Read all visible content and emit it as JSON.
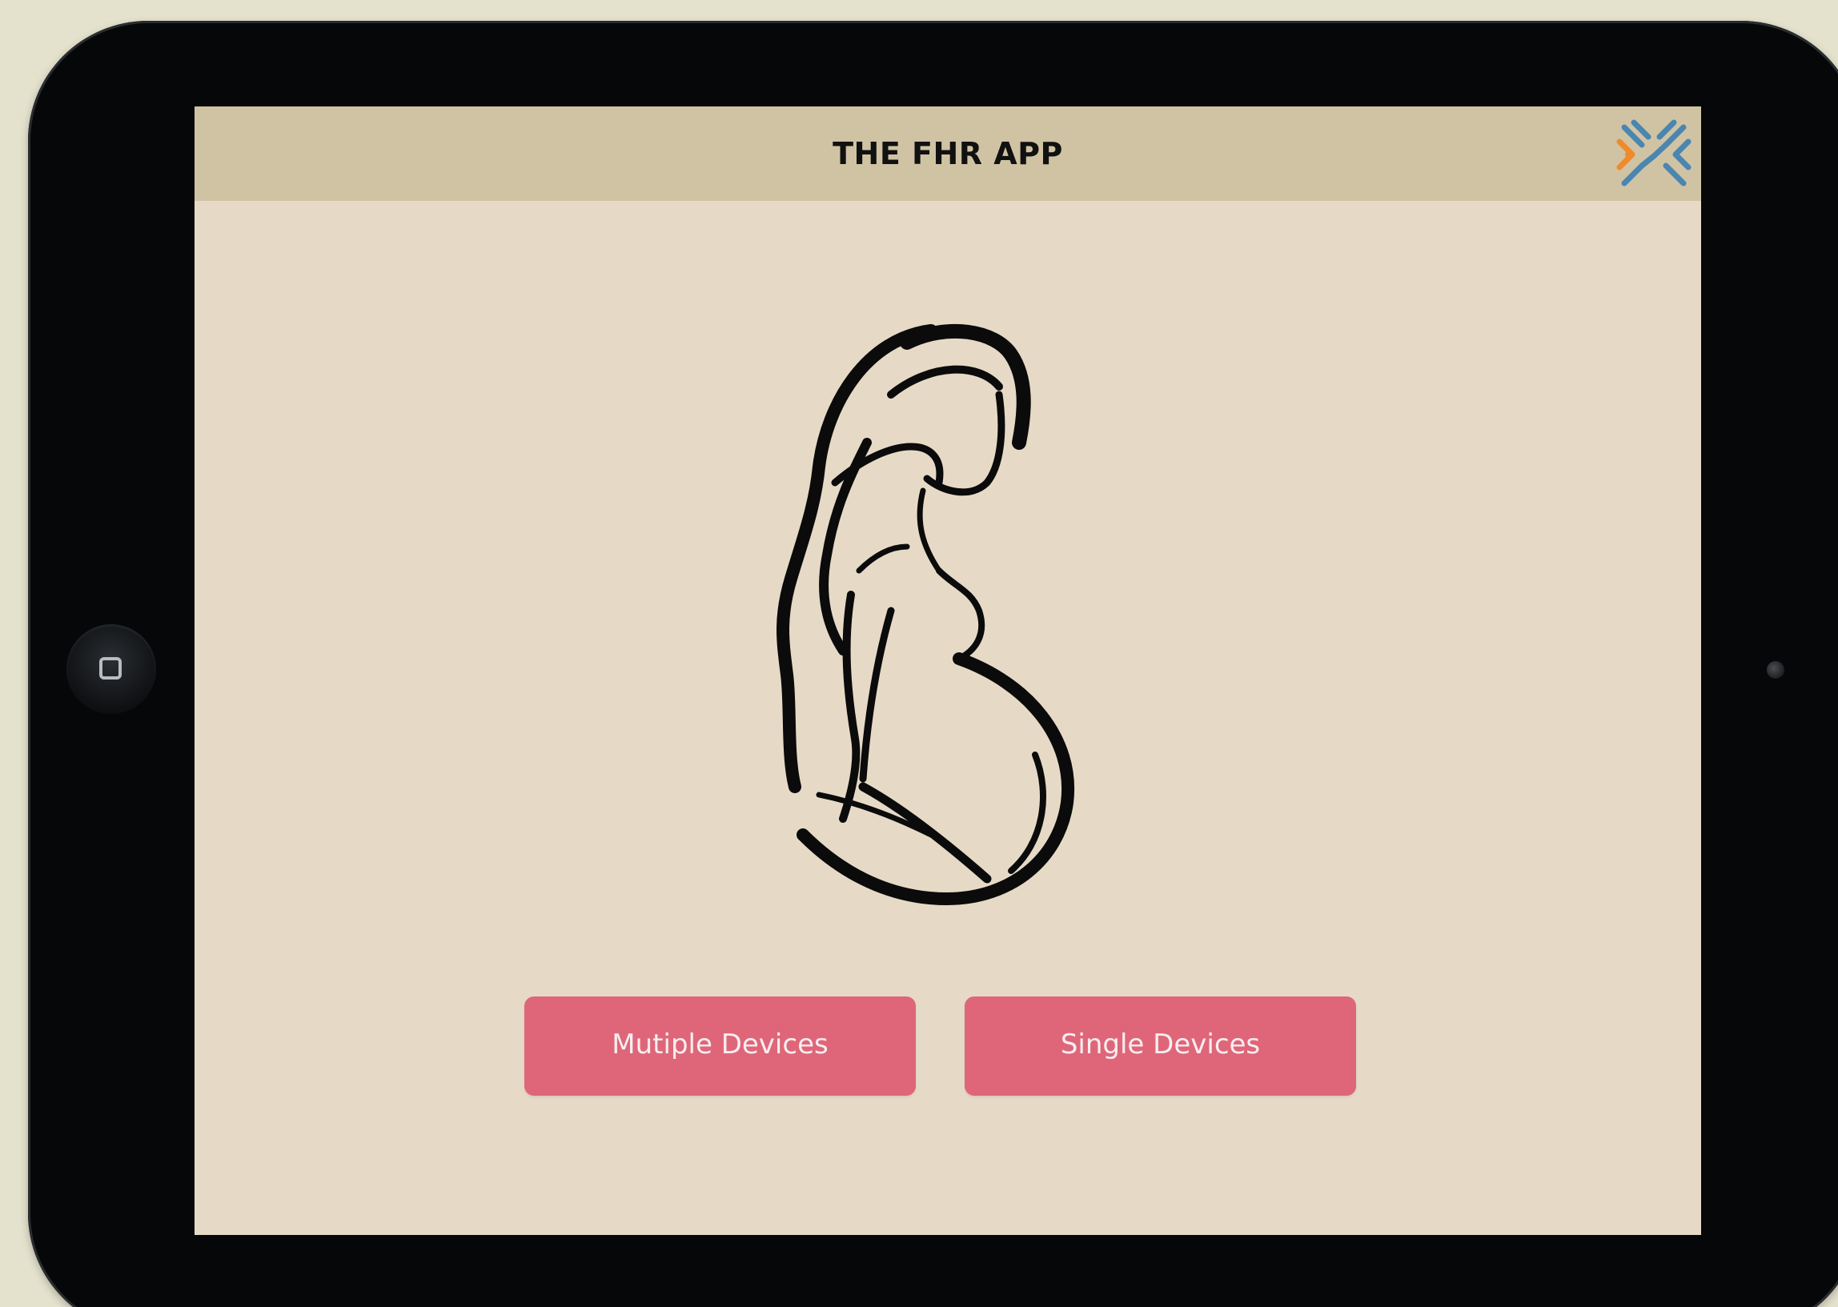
{
  "app": {
    "title": "THE FHR APP"
  },
  "buttons": {
    "multiple_label": "Mutiple Devices",
    "single_label": "Single Devices"
  },
  "colors": {
    "page_background": "#e4e2cd",
    "device_bezel": "#060708",
    "screen_background": "#e6dac7",
    "header_background": "#d0c3a4",
    "button_background": "#df6679",
    "button_text": "#f7eef0",
    "logo_orange": "#f08a2a",
    "logo_blue": "#4a86b0"
  },
  "icons": {
    "logo": "x-cross-logo-icon",
    "illustration": "pregnant-woman-silhouette-icon",
    "home_button": "home-button-icon"
  }
}
